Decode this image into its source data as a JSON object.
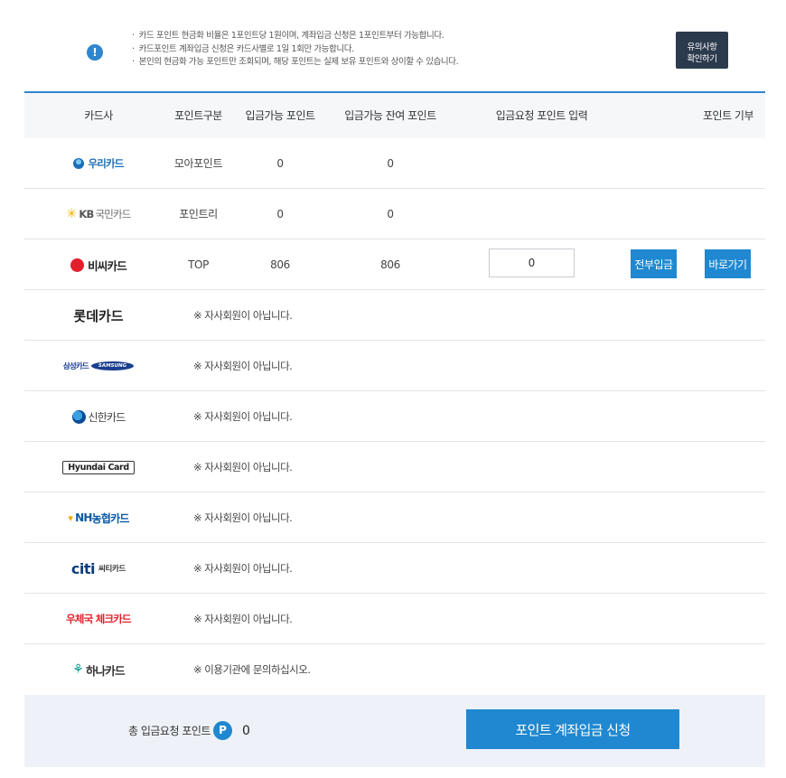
{
  "notice": {
    "icon": "exclamation-icon",
    "lines": [
      "카드 포인트 현금화 비율은 1포인트당 1원이며, 계좌입금 신청은 1포인트부터 가능합니다.",
      "카드포인트 계좌입금 신청은 카드사별로 1일 1회만 가능합니다.",
      "본인의 현금화 가능 포인트만 조회되며, 해당 포인트는 실제 보유 포인트와 상이할 수 있습니다."
    ],
    "button_line1": "유의사항",
    "button_line2": "확인하기"
  },
  "table": {
    "headers": {
      "card": "카드사",
      "type": "포인트구분",
      "available": "입금가능 포인트",
      "remaining": "입금가능 잔여 포인트",
      "request_input": "입금요청 포인트 입력",
      "donate": "포인트 기부"
    },
    "rows": [
      {
        "card": "우리카드",
        "type": "모아포인트",
        "available": "0",
        "remaining": "0"
      },
      {
        "card_kb": "KB",
        "card": "국민카드",
        "type": "포인트리",
        "available": "0",
        "remaining": "0"
      },
      {
        "card": "비씨카드",
        "type": "TOP",
        "available": "806",
        "remaining": "806",
        "input_value": "0",
        "all_button": "전부입금",
        "go_button": "바로가기"
      },
      {
        "card": "롯데카드",
        "message": "※ 자사회원이 아닙니다."
      },
      {
        "card": "삼성카드",
        "card_en": "SAMSUNG",
        "message": "※ 자사회원이 아닙니다."
      },
      {
        "card": "신한카드",
        "message": "※ 자사회원이 아닙니다."
      },
      {
        "card": "Hyundai Card",
        "message": "※ 자사회원이 아닙니다."
      },
      {
        "card_en": "NH",
        "card": "농협카드",
        "message": "※ 자사회원이 아닙니다."
      },
      {
        "card_en": "citi",
        "card": "씨티카드",
        "message": "※ 자사회원이 아닙니다."
      },
      {
        "card": "우체국 체크카드",
        "message": "※ 자사회원이 아닙니다."
      },
      {
        "card": "하나카드",
        "message": "※ 이용기관에 문의하십시오."
      }
    ]
  },
  "footer": {
    "total_label": "총 입금요청 포인트",
    "badge": "P",
    "total_value": "0",
    "submit_label": "포인트 계좌입금 신청"
  },
  "colors": {
    "accent": "#1f88d0",
    "notice_button": "#2c3a4e",
    "footer_bg": "#eef2f8"
  }
}
